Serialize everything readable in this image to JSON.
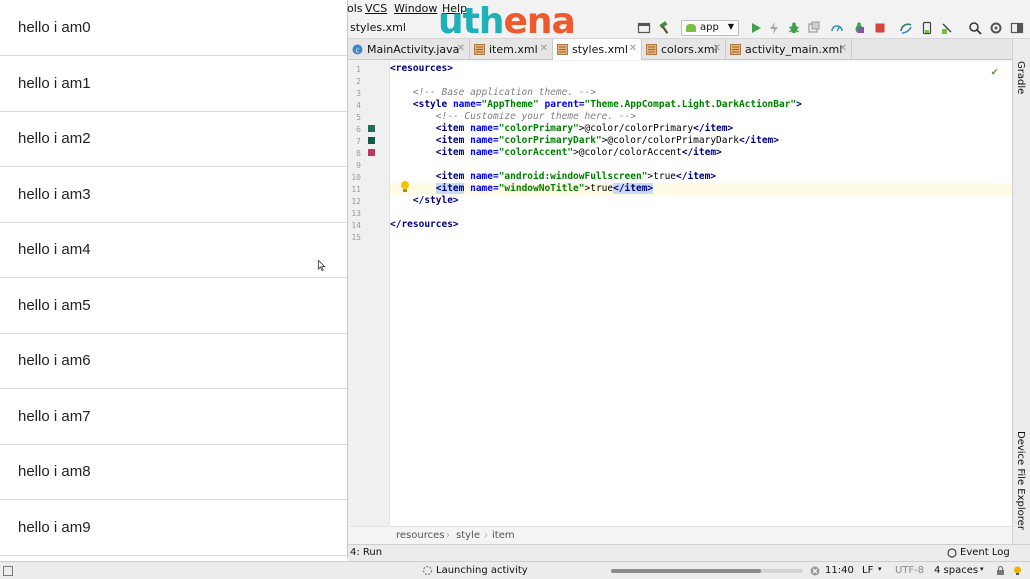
{
  "emulator": {
    "items": [
      "hello i am0",
      "hello i am1",
      "hello i am2",
      "hello i am3",
      "hello i am4",
      "hello i am5",
      "hello i am6",
      "hello i am7",
      "hello i am8",
      "hello i am9"
    ]
  },
  "menubar": {
    "tools": "ols",
    "vcs": "VCS",
    "window": "Window",
    "help": "Help"
  },
  "logo": {
    "part1": "uth",
    "part2": "ena"
  },
  "navbar": {
    "file": "styles.xml",
    "run_config": "app"
  },
  "tabs": [
    {
      "label": "MainActivity.java",
      "icon": "java-class-icon",
      "active": false
    },
    {
      "label": "item.xml",
      "icon": "layout-xml-icon",
      "active": false
    },
    {
      "label": "styles.xml",
      "icon": "values-xml-icon",
      "active": true
    },
    {
      "label": "colors.xml",
      "icon": "values-xml-icon",
      "active": false
    },
    {
      "label": "activity_main.xml",
      "icon": "layout-xml-icon",
      "active": false
    }
  ],
  "side_tools": {
    "gradle": "Gradle",
    "device_explorer": "Device File Explorer"
  },
  "editor": {
    "line_numbers": [
      "1",
      "2",
      "3",
      "4",
      "5",
      "6",
      "7",
      "8",
      "9",
      "10",
      "11",
      "12",
      "13",
      "14",
      "15"
    ],
    "code": {
      "l1": "<resources>",
      "l3": "<!-- Base application theme. -->",
      "l4a": "<style ",
      "l4b": "name=",
      "l4c": "\"AppTheme\" ",
      "l4d": "parent=",
      "l4e": "\"Theme.AppCompat.Light.DarkActionBar\"",
      "l4f": ">",
      "l5": "<!-- Customize your theme here. -->",
      "l6a": "<item ",
      "l6b": "name=",
      "l6c": "\"colorPrimary\"",
      "l6d": ">@color/colorPrimary",
      "l6e": "</item>",
      "l7a": "<item ",
      "l7b": "name=",
      "l7c": "\"colorPrimaryDark\"",
      "l7d": ">@color/colorPrimaryDark",
      "l7e": "</item>",
      "l8a": "<item ",
      "l8b": "name=",
      "l8c": "\"colorAccent\"",
      "l8d": ">@color/colorAccent",
      "l8e": "</item>",
      "l10a": "<item ",
      "l10b": "name=",
      "l10c": "\"android:windowFullscreen\"",
      "l10d": ">true",
      "l10e": "</item>",
      "l11a": "<item",
      "l11b": " name=",
      "l11c": "\"windowNoTitle\"",
      "l11d": ">true",
      "l11e": "</item>",
      "l12": "</style>",
      "l14": "</resources>"
    },
    "swatch_colors": {
      "primary": "#1f6e5a",
      "primary_dark": "#155a48",
      "accent": "#c0395a"
    }
  },
  "breadcrumb": [
    "resources",
    "style",
    "item"
  ],
  "runbar": {
    "run": "4: Run",
    "event_log": "Event Log"
  },
  "statusbar": {
    "task": "Launching activity",
    "progress": 0.78,
    "position": "11:40",
    "line_sep": "LF",
    "encoding": "UTF-8",
    "indent": "4 spaces"
  }
}
